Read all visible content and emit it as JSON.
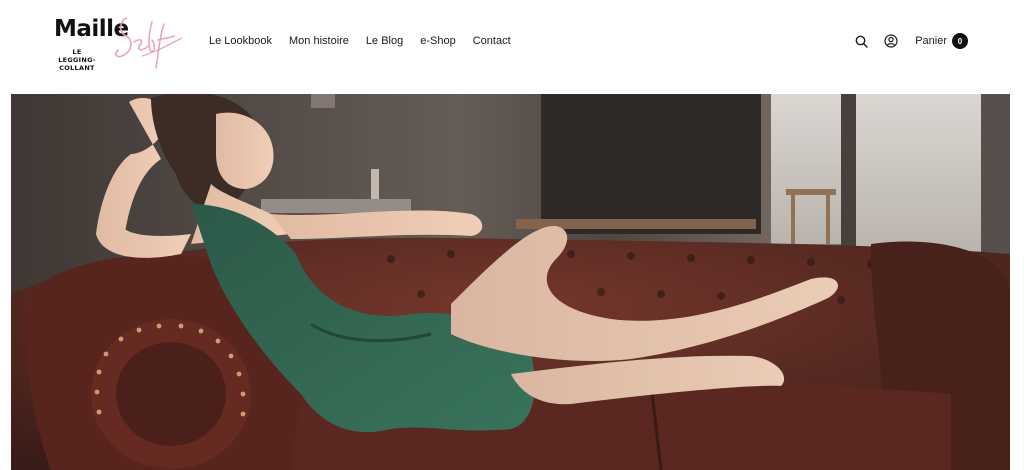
{
  "brand": {
    "name": "Maille",
    "script": "Self",
    "tagline_line1": "LE",
    "tagline_line2": "LEGGING-",
    "tagline_line3": "COLLANT"
  },
  "nav": {
    "items": [
      {
        "label": "Le Lookbook"
      },
      {
        "label": "Mon histoire"
      },
      {
        "label": "Le Blog"
      },
      {
        "label": "e-Shop"
      },
      {
        "label": "Contact"
      }
    ]
  },
  "tools": {
    "search_icon": "search-icon",
    "account_icon": "user-icon",
    "cart_label": "Panier",
    "cart_count": "0"
  },
  "colors": {
    "accent_pink": "#e8a0b8",
    "text_dark": "#1a1a1a",
    "badge_bg": "#111111",
    "dress_green": "#1f5a45",
    "sofa_leather": "#4a1a14"
  },
  "hero": {
    "image_subject": "woman in green dress reclining on brown leather chesterfield sofa"
  }
}
